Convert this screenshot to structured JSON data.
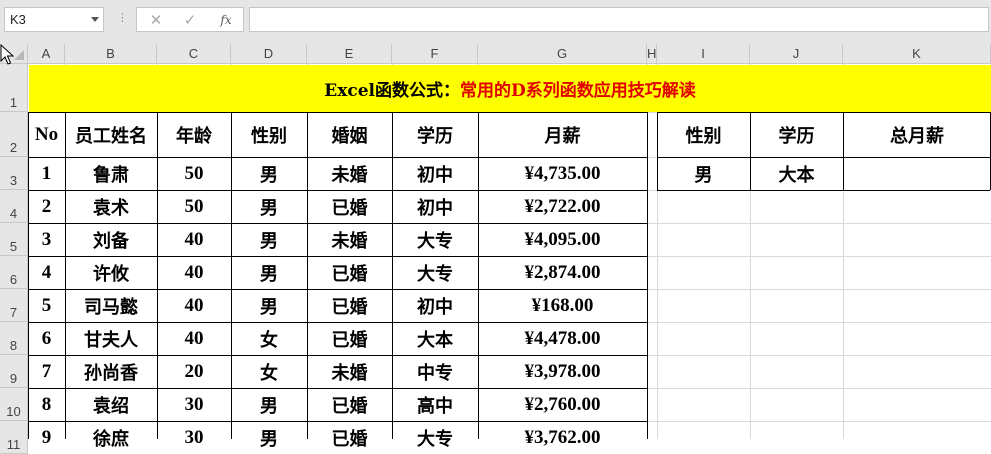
{
  "formula_bar": {
    "name_box": "K3",
    "cancel_icon": "✕",
    "enter_icon": "✓",
    "fx_label": "fx",
    "formula": ""
  },
  "columns": [
    "A",
    "B",
    "C",
    "D",
    "E",
    "F",
    "G",
    "H",
    "I",
    "J",
    "K"
  ],
  "rows": [
    "1",
    "2",
    "3",
    "4",
    "5",
    "6",
    "7",
    "8",
    "9",
    "10",
    "11"
  ],
  "title": {
    "prefix": "Excel函数公式：",
    "main": "常用的D系列函数应用技巧解读"
  },
  "colors": {
    "title_bg": "#ffff00",
    "title_red": "#e00000",
    "header_bg": "#e6e6e6"
  },
  "table": {
    "headers": [
      "No",
      "员工姓名",
      "年龄",
      "性别",
      "婚姻",
      "学历",
      "月薪"
    ],
    "rows": [
      [
        "1",
        "鲁肃",
        "50",
        "男",
        "未婚",
        "初中",
        "¥4,735.00"
      ],
      [
        "2",
        "袁术",
        "50",
        "男",
        "已婚",
        "初中",
        "¥2,722.00"
      ],
      [
        "3",
        "刘备",
        "40",
        "男",
        "未婚",
        "大专",
        "¥4,095.00"
      ],
      [
        "4",
        "许攸",
        "40",
        "男",
        "已婚",
        "大专",
        "¥2,874.00"
      ],
      [
        "5",
        "司马懿",
        "40",
        "男",
        "已婚",
        "初中",
        "¥168.00"
      ],
      [
        "6",
        "甘夫人",
        "40",
        "女",
        "已婚",
        "大本",
        "¥4,478.00"
      ],
      [
        "7",
        "孙尚香",
        "20",
        "女",
        "未婚",
        "中专",
        "¥3,978.00"
      ],
      [
        "8",
        "袁绍",
        "30",
        "男",
        "已婚",
        "高中",
        "¥2,760.00"
      ],
      [
        "9",
        "徐庶",
        "30",
        "男",
        "已婚",
        "大专",
        "¥3,762.00"
      ]
    ]
  },
  "criteria": {
    "headers": [
      "性别",
      "学历",
      "总月薪"
    ],
    "values": [
      "男",
      "大本",
      ""
    ]
  }
}
